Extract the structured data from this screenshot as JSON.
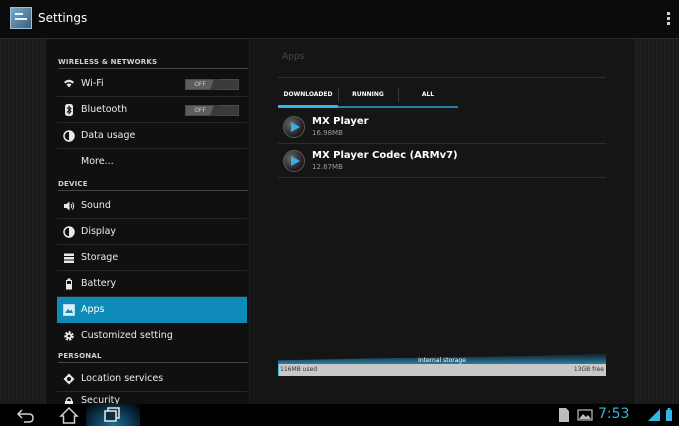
{
  "actionbar": {
    "title": "Settings"
  },
  "sections": {
    "wireless": "WIRELESS & NETWORKS",
    "device": "DEVICE",
    "personal": "PERSONAL"
  },
  "left_items": [
    {
      "label": "Wi-Fi",
      "icon": "wifi-icon",
      "toggle": "OFF"
    },
    {
      "label": "Bluetooth",
      "icon": "bluetooth-icon",
      "toggle": "OFF"
    },
    {
      "label": "Data usage",
      "icon": "data-usage-icon"
    },
    {
      "label": "More..."
    },
    {
      "label": "Sound",
      "icon": "sound-icon"
    },
    {
      "label": "Display",
      "icon": "display-icon"
    },
    {
      "label": "Storage",
      "icon": "storage-icon"
    },
    {
      "label": "Battery",
      "icon": "battery-icon"
    },
    {
      "label": "Apps",
      "icon": "apps-icon",
      "selected": true
    },
    {
      "label": "Customized setting",
      "icon": "gear-icon"
    },
    {
      "label": "Location services",
      "icon": "location-icon"
    },
    {
      "label": "Security",
      "icon": "lock-icon"
    }
  ],
  "apps": {
    "title": "Apps",
    "tabs": [
      "DOWNLOADED",
      "RUNNING",
      "ALL"
    ],
    "active_tab": "DOWNLOADED",
    "list": [
      {
        "name": "MX Player",
        "size": "16.98MB"
      },
      {
        "name": "MX Player Codec (ARMv7)",
        "size": "12.67MB"
      }
    ],
    "storage": {
      "label": "Internal storage",
      "used": "116MB used",
      "free": "13GB free"
    }
  },
  "statusbar": {
    "time": "7:53"
  },
  "colors": {
    "accent": "#33b5e5",
    "selected": "#0e8bb8"
  }
}
